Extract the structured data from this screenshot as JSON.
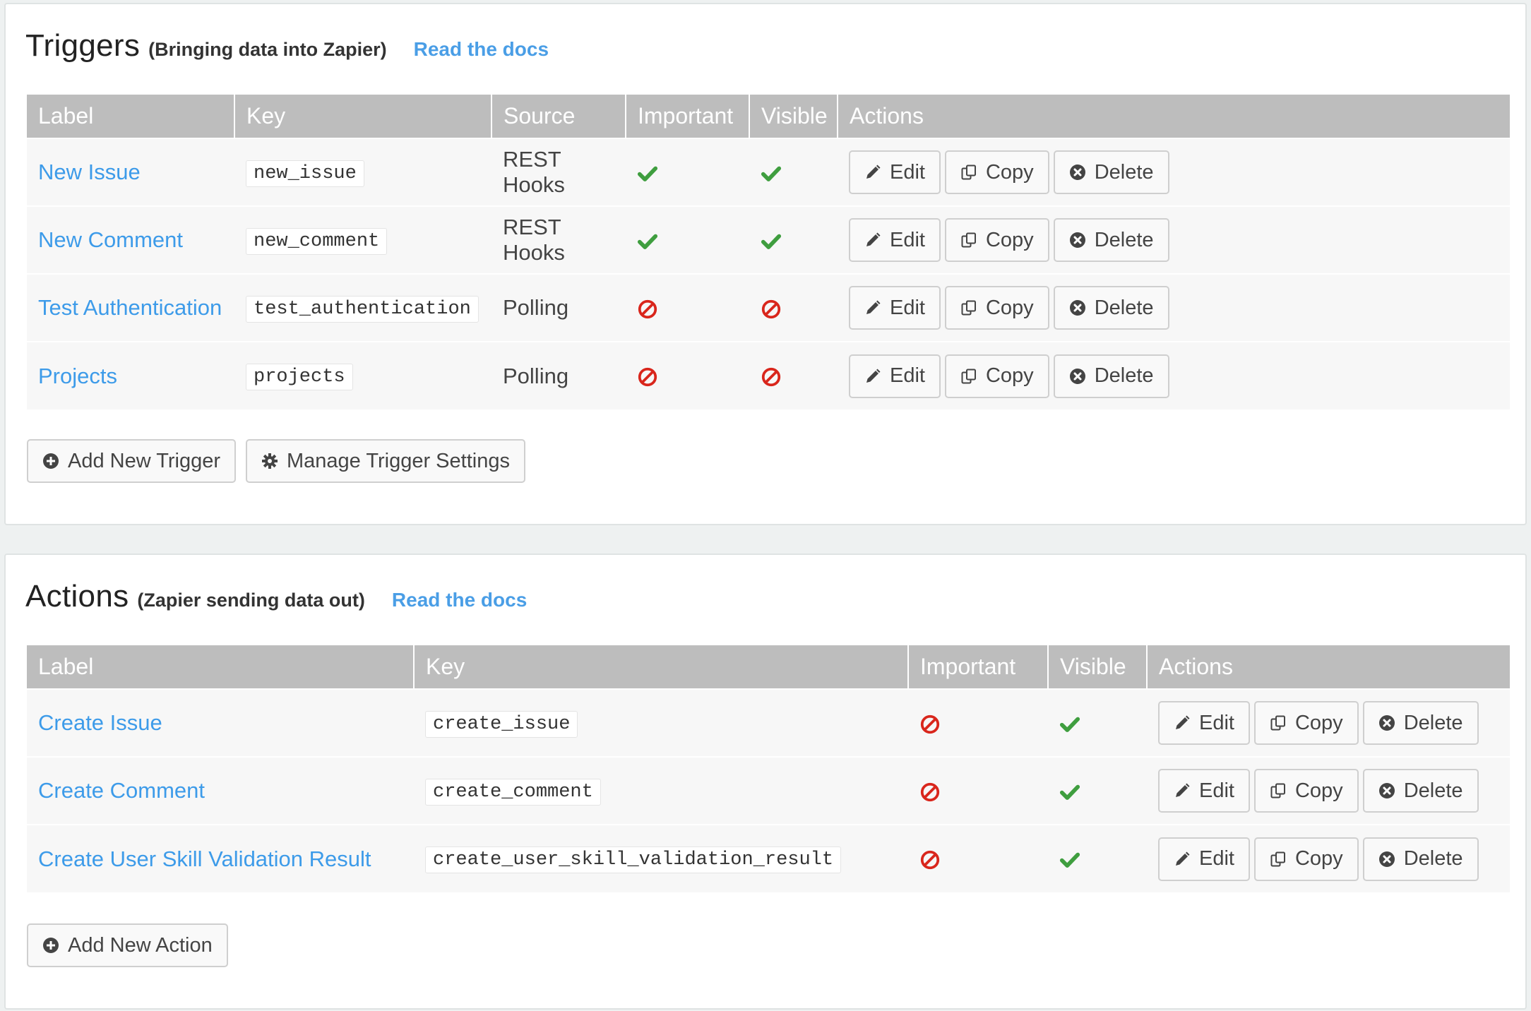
{
  "triggers": {
    "title": "Triggers",
    "subtitle": "(Bringing data into Zapier)",
    "docs_link": "Read the docs",
    "columns": [
      "Label",
      "Key",
      "Source",
      "Important",
      "Visible",
      "Actions"
    ],
    "rows": [
      {
        "label": "New Issue",
        "key": "new_issue",
        "source": "REST Hooks",
        "important": "check",
        "visible": "check"
      },
      {
        "label": "New Comment",
        "key": "new_comment",
        "source": "REST Hooks",
        "important": "check",
        "visible": "check"
      },
      {
        "label": "Test Authentication",
        "key": "test_authentication",
        "source": "Polling",
        "important": "ban",
        "visible": "ban"
      },
      {
        "label": "Projects",
        "key": "projects",
        "source": "Polling",
        "important": "ban",
        "visible": "ban"
      }
    ],
    "add_button": "Add New Trigger",
    "settings_button": "Manage Trigger Settings"
  },
  "actions": {
    "title": "Actions",
    "subtitle": "(Zapier sending data out)",
    "docs_link": "Read the docs",
    "columns": [
      "Label",
      "Key",
      "Important",
      "Visible",
      "Actions"
    ],
    "rows": [
      {
        "label": "Create Issue",
        "key": "create_issue",
        "important": "ban",
        "visible": "check"
      },
      {
        "label": "Create Comment",
        "key": "create_comment",
        "important": "ban",
        "visible": "check"
      },
      {
        "label": "Create User Skill Validation Result",
        "key": "create_user_skill_validation_result",
        "important": "ban",
        "visible": "check"
      }
    ],
    "add_button": "Add New Action"
  },
  "row_buttons": {
    "edit": "Edit",
    "copy": "Copy",
    "delete": "Delete"
  },
  "icons": {
    "check": "check-icon",
    "ban": "ban-icon",
    "edit": "pencil-icon",
    "copy": "copy-icon",
    "delete": "times-circle-icon",
    "add": "plus-circle-icon",
    "settings": "gear-icon"
  },
  "colors": {
    "link": "#3d9be9",
    "check": "#3f9e3f",
    "ban": "#d9261c",
    "header_bg": "#bdbdbd",
    "row_bg": "#f7f7f7"
  }
}
